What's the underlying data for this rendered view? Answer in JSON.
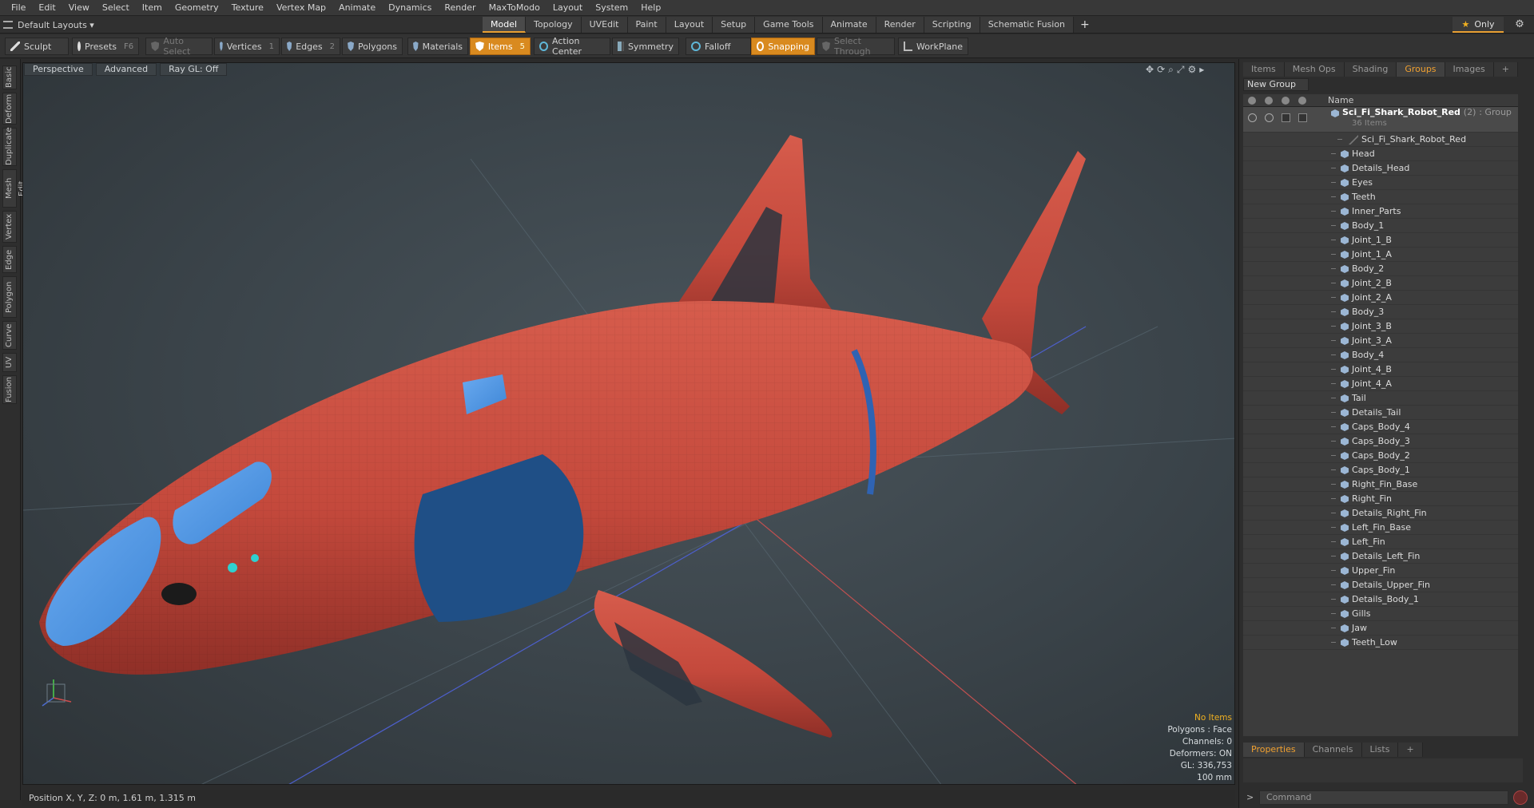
{
  "menu": [
    "File",
    "Edit",
    "View",
    "Select",
    "Item",
    "Geometry",
    "Texture",
    "Vertex Map",
    "Animate",
    "Dynamics",
    "Render",
    "MaxToModo",
    "Layout",
    "System",
    "Help"
  ],
  "layout_dropdown": "Default Layouts ▾",
  "mode_tabs": [
    "Model",
    "Topology",
    "UVEdit",
    "Paint",
    "Layout",
    "Setup",
    "Game Tools",
    "Animate",
    "Render",
    "Scripting",
    "Schematic Fusion"
  ],
  "mode_tabs_plus": "+",
  "only_label": "Only",
  "toolbar": {
    "sculpt": "Sculpt",
    "presets": "Presets",
    "presets_key": "F6",
    "auto_select": "Auto Select",
    "vertices": "Vertices",
    "vertices_num": "1",
    "edges": "Edges",
    "edges_num": "2",
    "polygons": "Polygons",
    "materials": "Materials",
    "items": "Items",
    "items_num": "5",
    "action_center": "Action Center",
    "symmetry": "Symmetry",
    "falloff": "Falloff",
    "snapping": "Snapping",
    "select_through": "Select Through",
    "workplane": "WorkPlane"
  },
  "left_tabs": [
    "Basic",
    "Deform",
    "Duplicate",
    "Mesh Edit",
    "Vertex",
    "Edge",
    "Polygon",
    "Curve",
    "UV",
    "Fusion"
  ],
  "viewport": {
    "view": "Perspective",
    "shading": "Advanced",
    "raygl": "Ray GL: Off",
    "info": {
      "no_items": "No Items",
      "polygons": "Polygons : Face",
      "channels": "Channels: 0",
      "deformers": "Deformers: ON",
      "gl": "GL: 336,753",
      "unit": "100 mm"
    },
    "position": "Position X, Y, Z:  0 m, 1.61 m, 1.315 m"
  },
  "right_panel": {
    "tabs": [
      "Items",
      "Mesh Ops",
      "Shading",
      "Groups",
      "Images",
      "+"
    ],
    "active_tab": "Groups",
    "new_group": "New Group",
    "col_name": "Name",
    "group": {
      "name": "Sci_Fi_Shark_Robot_Red",
      "count": "(2)",
      "kind": ": Group",
      "items": "36 Items"
    },
    "children": [
      "Sci_Fi_Shark_Robot_Red",
      "Head",
      "Details_Head",
      "Eyes",
      "Teeth",
      "Inner_Parts",
      "Body_1",
      "Joint_1_B",
      "Joint_1_A",
      "Body_2",
      "Joint_2_B",
      "Joint_2_A",
      "Body_3",
      "Joint_3_B",
      "Joint_3_A",
      "Body_4",
      "Joint_4_B",
      "Joint_4_A",
      "Tail",
      "Details_Tail",
      "Caps_Body_4",
      "Caps_Body_3",
      "Caps_Body_2",
      "Caps_Body_1",
      "Right_Fin_Base",
      "Right_Fin",
      "Details_Right_Fin",
      "Left_Fin_Base",
      "Left_Fin",
      "Details_Left_Fin",
      "Upper_Fin",
      "Details_Upper_Fin",
      "Details_Body_1",
      "Gills",
      "Jaw",
      "Teeth_Low"
    ],
    "bottom_tabs": [
      "Properties",
      "Channels",
      "Lists",
      "+"
    ],
    "command_placeholder": "Command"
  },
  "colors": {
    "accent": "#e8a033",
    "shark_red": "#c4493c",
    "shark_blue": "#3e86d6"
  }
}
